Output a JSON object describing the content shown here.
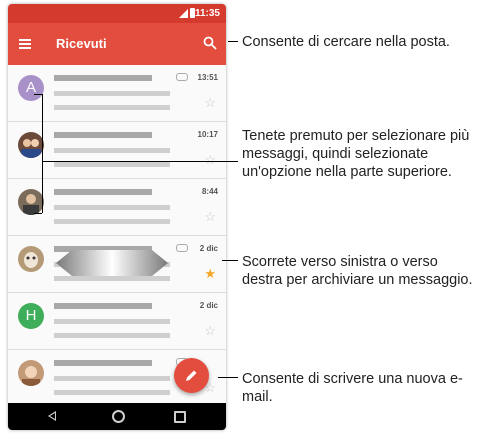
{
  "status_bar": {
    "time": "11:35"
  },
  "app_bar": {
    "title": "Ricevuti"
  },
  "messages": [
    {
      "avatar": "A",
      "avatar_color": "#a890c8",
      "date": "13:51",
      "attachment": true,
      "starred": false
    },
    {
      "avatar": "",
      "avatar_color": "#6b4a3a",
      "date": "10:17",
      "attachment": false,
      "starred": false
    },
    {
      "avatar": "",
      "avatar_color": "#7a6b5a",
      "date": "8:44",
      "attachment": false,
      "starred": false
    },
    {
      "avatar": "",
      "avatar_color": "#b59a78",
      "date": "2 dic",
      "attachment": true,
      "starred": true
    },
    {
      "avatar": "H",
      "avatar_color": "#3fae5a",
      "date": "2 dic",
      "attachment": false,
      "starred": false
    },
    {
      "avatar": "",
      "avatar_color": "#c39a78",
      "date": "",
      "attachment": true,
      "starred": false
    }
  ],
  "callouts": {
    "search": "Consente di cercare nella posta.",
    "select": "Tenete premuto per selezionare più messaggi, quindi selezionate un'opzione nella parte superiore.",
    "swipe": "Scorrete verso sinistra o verso destra per archiviare un messaggio.",
    "compose": "Consente di scrivere una nuova e-mail."
  },
  "icons": {
    "menu": "hamburger-icon",
    "search": "search-icon",
    "attachment": "attachment-icon",
    "star": "star-icon",
    "compose": "pencil-icon",
    "back": "back-icon",
    "home": "home-icon",
    "recents": "recents-icon"
  },
  "colors": {
    "app_bar": "#e34d3d",
    "status_bar": "#d53a2f",
    "fab": "#e34d3d",
    "star_active": "#f5a623"
  }
}
